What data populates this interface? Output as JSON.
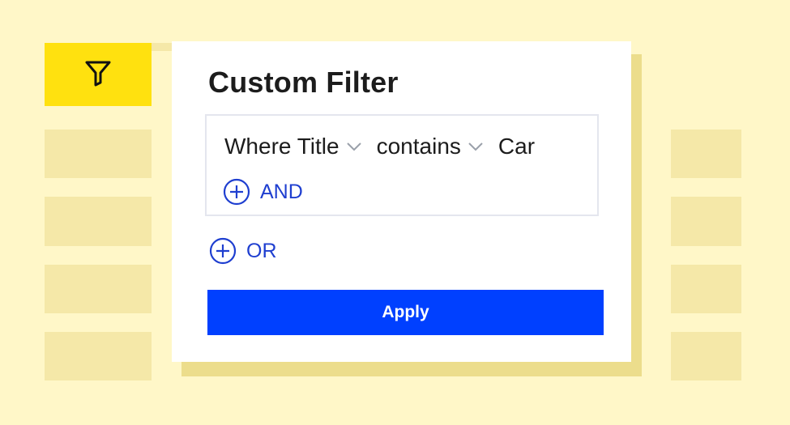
{
  "colors": {
    "background": "#fff7c8",
    "placeholder_block": "#f5e8a8",
    "filter_button": "#ffe10f",
    "accent_blue": "#0040ff",
    "link_blue": "#1f3fd0"
  },
  "toolbar": {
    "filter_icon": "funnel-icon"
  },
  "dialog": {
    "title": "Custom Filter",
    "rule": {
      "field": "Where Title",
      "operator": "contains",
      "value": "Car"
    },
    "and_label": "AND",
    "or_label": "OR",
    "apply_label": "Apply"
  }
}
